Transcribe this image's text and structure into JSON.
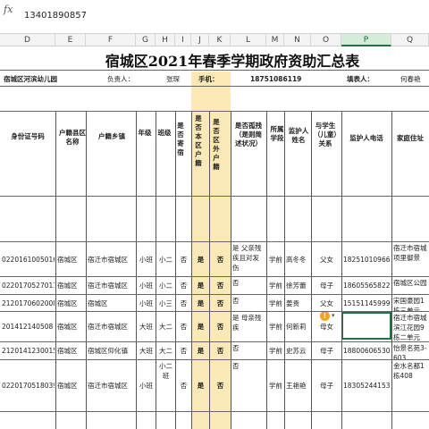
{
  "formula_bar": {
    "fx": "fx",
    "value": "13401890857"
  },
  "columns": [
    "D",
    "E",
    "F",
    "G",
    "H",
    "I",
    "J",
    "K",
    "L",
    "M",
    "N",
    "O",
    "P",
    "Q"
  ],
  "selected_column": "P",
  "title": "宿城区2021年春季学期政府资助汇总表",
  "info_row": {
    "school": "宿城区河滨幼儿园",
    "leader_label": "负责人：",
    "leader": "张琛",
    "phone_label": "手机：",
    "phone": "18751086119",
    "filler_label": "填表人：",
    "filler": "何春艳"
  },
  "headers": {
    "id": "身份证号码",
    "district": "户籍县区名称",
    "town": "户籍乡镇",
    "grade": "年级",
    "class": "班级",
    "boarding": "是否寄宿",
    "local": "是否本区户籍",
    "outside": "是否区外户籍",
    "orphan": "是否孤残（是则简述状况）",
    "stage": "所属学段",
    "guardian": "监护人姓名",
    "relation": "与学生（儿童）关系",
    "guardian_phone": "监护人电话",
    "address": "家庭住址"
  },
  "rows": [
    {
      "id": "02201610050167",
      "district": "宿城区",
      "town": "宿迁市宿城区",
      "grade": "小班",
      "class": "小二",
      "boarding": "否",
      "local": "是",
      "outside": "否",
      "orphan": "是 父亲残疾且对发伤",
      "stage": "学前",
      "guardian": "高冬冬",
      "relation": "父女",
      "phone": "18251010966",
      "address": "宿迁市宿城项里御景"
    },
    {
      "id": "02201705270111",
      "district": "宿城区",
      "town": "宿迁市宿城区",
      "grade": "小班",
      "class": "小二",
      "boarding": "否",
      "local": "是",
      "outside": "否",
      "orphan": "否",
      "stage": "学前",
      "guardian": "徐芳蕾",
      "relation": "母子",
      "phone": "18605565822",
      "address": "宿城区公园"
    },
    {
      "id": "21201706020084",
      "district": "宿城区",
      "town": "宿城区",
      "grade": "小班",
      "class": "小三",
      "boarding": "否",
      "local": "是",
      "outside": "否",
      "orphan": "否",
      "stage": "学前",
      "guardian": "姜贵",
      "relation": "父女",
      "phone": "15151145999",
      "address": "宋国豪园1栋三单元"
    },
    {
      "id": "201412140508",
      "district": "宿城区",
      "town": "宿迁市宿城区",
      "grade": "大班",
      "class": "大二",
      "boarding": "否",
      "local": "是",
      "outside": "否",
      "orphan": "是 母亲残疾",
      "stage": "学前",
      "guardian": "何新莉",
      "relation": "母女",
      "phone": "13401890857",
      "address": "宿迁市宿城滨江花园9栋二单元301"
    },
    {
      "id": "21201412300152",
      "district": "宿城区",
      "town": "宿城区仰化镇",
      "grade": "大班",
      "class": "大二",
      "boarding": "否",
      "local": "是",
      "outside": "否",
      "orphan": "否",
      "stage": "学前",
      "guardian": "史苏云",
      "relation": "母子",
      "phone": "18800606530",
      "address": "怡景名苑3-603"
    },
    {
      "id": "02201705180394",
      "district": "宿城区",
      "town": "宿迁市宿城区",
      "grade": "小班",
      "class": "小二班",
      "boarding": "否",
      "local": "是",
      "outside": "否",
      "orphan": "否",
      "stage": "学前",
      "guardian": "王艳艳",
      "relation": "母子",
      "phone": "18305244153",
      "address": "金水名都1栋408"
    }
  ],
  "colors": {
    "selection": "#217346",
    "highlight": "#fbe9b8",
    "warning": "#f2a51a"
  }
}
